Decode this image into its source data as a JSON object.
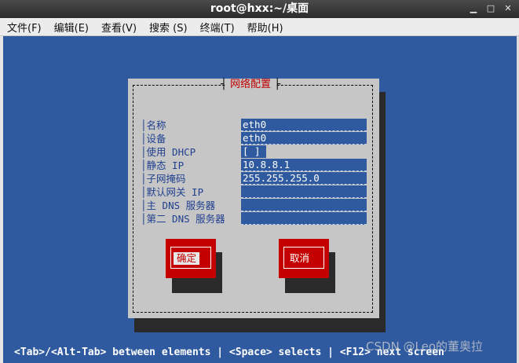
{
  "window": {
    "title": "root@hxx:~/桌面",
    "controls": [
      "minimize-icon",
      "maximize-icon",
      "close-icon"
    ]
  },
  "menu": {
    "file": "文件(F)",
    "edit": "编辑(E)",
    "view": "查看(V)",
    "search": "搜索 (S)",
    "terminal": "终端(T)",
    "help": "帮助(H)"
  },
  "dialog": {
    "title": "网络配置",
    "fields": [
      {
        "label": "名称",
        "value": "eth0"
      },
      {
        "label": "设备",
        "value": "eth0"
      },
      {
        "label": "使用 DHCP",
        "value": "[ ]"
      },
      {
        "label": "静态 IP",
        "value": "10.8.8.1"
      },
      {
        "label": "子网掩码",
        "value": "255.255.255.0"
      },
      {
        "label": "默认网关 IP",
        "value": ""
      },
      {
        "label": "主 DNS 服务器",
        "value": ""
      },
      {
        "label": "第二 DNS 服务器",
        "value": ""
      }
    ],
    "ok_button": "确定",
    "cancel_button": "取消"
  },
  "status_bar": "<Tab>/<Alt-Tab> between elements   |  <Space> selects   |  <F12> next screen",
  "watermark": "CSDN @Leo的董奥拉",
  "colors": {
    "terminal_bg": "#2f5aa0",
    "dialog_bg": "#c6c6c6",
    "button_bg": "#c40000",
    "label_text": "#1f3f8f",
    "title_text": "#c00000"
  }
}
